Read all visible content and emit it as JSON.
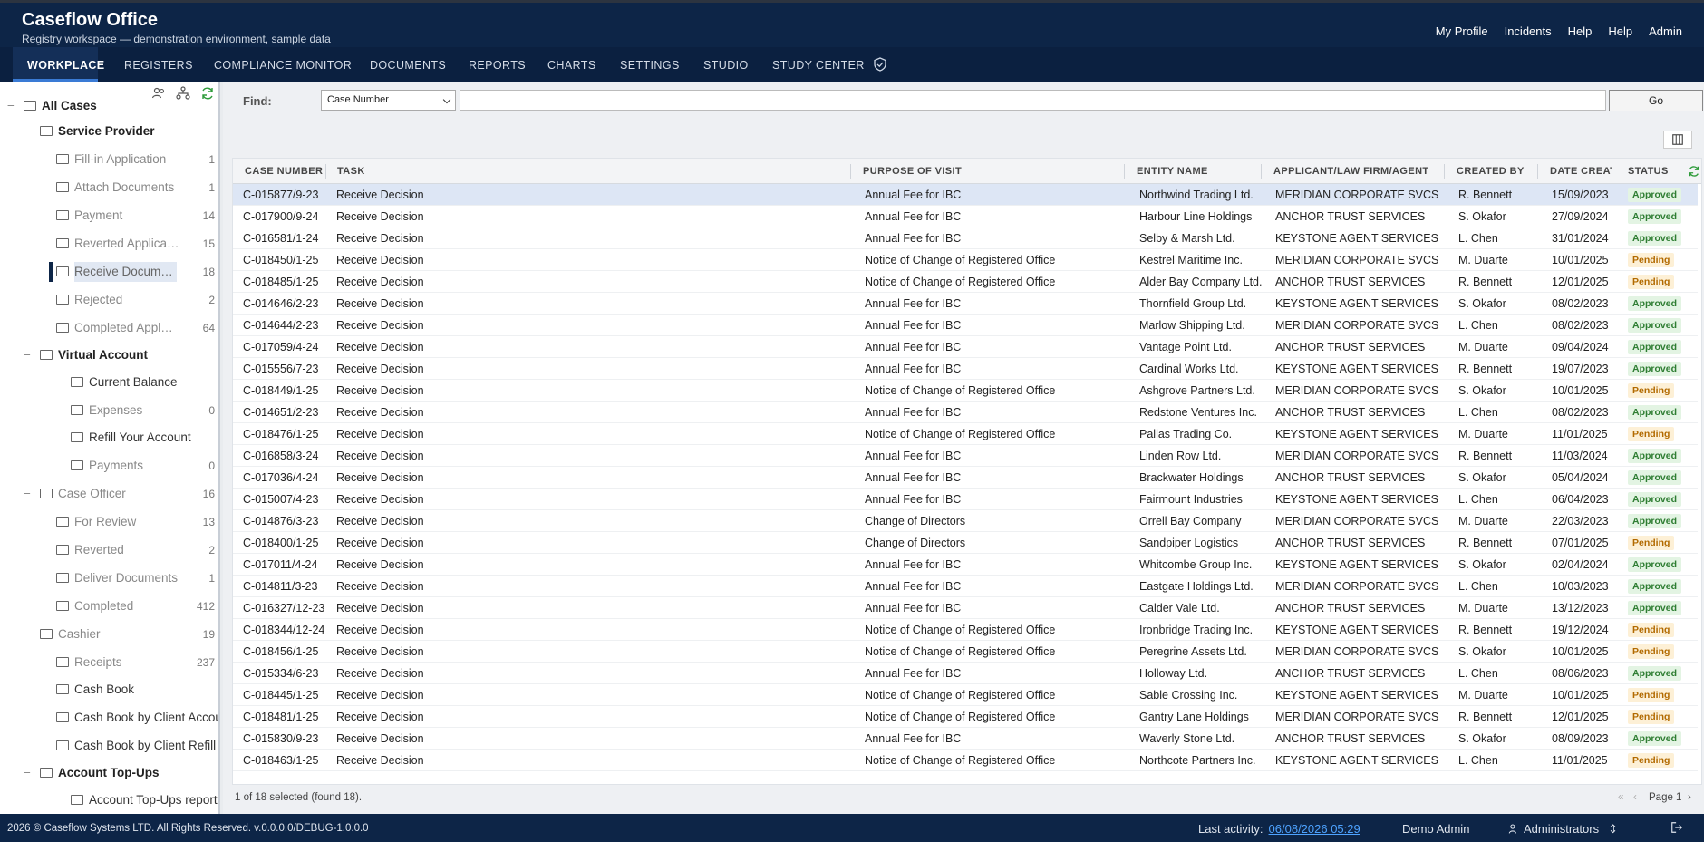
{
  "app": {
    "title": "Caseflow Office",
    "subtitle": "Registry workspace — demonstration environment, sample data"
  },
  "top_links": [
    "My Profile",
    "Incidents",
    "Help",
    "Help",
    "Admin"
  ],
  "nav": {
    "tabs": [
      "WORKPLACE",
      "REGISTERS",
      "COMPLIANCE MONITOR",
      "DOCUMENTS",
      "REPORTS",
      "CHARTS",
      "SETTINGS",
      "STUDIO",
      "STUDY CENTER"
    ],
    "active": "WORKPLACE"
  },
  "tree": [
    {
      "label": "All Cases",
      "count": "",
      "toggle": "−",
      "style": "bold"
    },
    {
      "label": "Service Provider",
      "count": "",
      "toggle": "−",
      "style": "bold"
    },
    {
      "label": "Fill-in Application",
      "count": "1",
      "toggle": "",
      "style": ""
    },
    {
      "label": "Attach Documents",
      "count": "1",
      "toggle": "",
      "style": ""
    },
    {
      "label": "Payment",
      "count": "14",
      "toggle": "",
      "style": ""
    },
    {
      "label": "Reverted Applica…",
      "count": "15",
      "toggle": "",
      "style": ""
    },
    {
      "label": "Receive Docum…",
      "count": "18",
      "toggle": "",
      "style": "sel"
    },
    {
      "label": "Rejected",
      "count": "2",
      "toggle": "",
      "style": ""
    },
    {
      "label": "Completed Appl…",
      "count": "64",
      "toggle": "",
      "style": ""
    },
    {
      "label": "Virtual Account",
      "count": "",
      "toggle": "−",
      "style": "bold"
    },
    {
      "label": "Current Balance",
      "count": "",
      "toggle": "",
      "style": "dark"
    },
    {
      "label": "Expenses",
      "count": "0",
      "toggle": "",
      "style": ""
    },
    {
      "label": "Refill Your Account",
      "count": "",
      "toggle": "",
      "style": "dark"
    },
    {
      "label": "Payments",
      "count": "0",
      "toggle": "",
      "style": ""
    },
    {
      "label": "Case Officer",
      "count": "16",
      "toggle": "−",
      "style": ""
    },
    {
      "label": "For Review",
      "count": "13",
      "toggle": "",
      "style": ""
    },
    {
      "label": "Reverted",
      "count": "2",
      "toggle": "",
      "style": ""
    },
    {
      "label": "Deliver Documents",
      "count": "1",
      "toggle": "",
      "style": ""
    },
    {
      "label": "Completed",
      "count": "412",
      "toggle": "",
      "style": ""
    },
    {
      "label": "Cashier",
      "count": "19",
      "toggle": "−",
      "style": ""
    },
    {
      "label": "Receipts",
      "count": "237",
      "toggle": "",
      "style": ""
    },
    {
      "label": "Cash Book",
      "count": "",
      "toggle": "",
      "style": "dark"
    },
    {
      "label": "Cash Book by Client Accou",
      "count": "",
      "toggle": "",
      "style": "dark"
    },
    {
      "label": "Cash Book by Client Refill",
      "count": "",
      "toggle": "",
      "style": "dark"
    },
    {
      "label": "Account Top-Ups",
      "count": "",
      "toggle": "−",
      "style": "bold"
    },
    {
      "label": "Account Top-Ups report",
      "count": "",
      "toggle": "",
      "style": "dark"
    }
  ],
  "find": {
    "label": "Find:",
    "select_value": "Case Number",
    "go": "Go"
  },
  "grid": {
    "columns": [
      "CASE NUMBER",
      "TASK",
      "PURPOSE OF VISIT",
      "ENTITY NAME",
      "APPLICANT/LAW FIRM/AGENT",
      "CREATED BY",
      "DATE CREATE",
      "STATUS"
    ],
    "rows": [
      [
        "C-015877/9-23",
        "Receive Decision",
        "Annual Fee for IBC",
        "Northwind Trading Ltd.",
        "MERIDIAN CORPORATE SVCS",
        "R. Bennett",
        "15/09/2023",
        "Approved"
      ],
      [
        "C-017900/9-24",
        "Receive Decision",
        "Annual Fee for IBC",
        "Harbour Line Holdings",
        "ANCHOR TRUST SERVICES",
        "S. Okafor",
        "27/09/2024",
        "Approved"
      ],
      [
        "C-016581/1-24",
        "Receive Decision",
        "Annual Fee for IBC",
        "Selby & Marsh Ltd.",
        "KEYSTONE AGENT SERVICES",
        "L. Chen",
        "31/01/2024",
        "Approved"
      ],
      [
        "C-018450/1-25",
        "Receive Decision",
        "Notice of Change of Registered Office",
        "Kestrel Maritime Inc.",
        "MERIDIAN CORPORATE SVCS",
        "M. Duarte",
        "10/01/2025",
        "Pending"
      ],
      [
        "C-018485/1-25",
        "Receive Decision",
        "Notice of Change of Registered Office",
        "Alder Bay Company Ltd.",
        "ANCHOR TRUST SERVICES",
        "R. Bennett",
        "12/01/2025",
        "Pending"
      ],
      [
        "C-014646/2-23",
        "Receive Decision",
        "Annual Fee for IBC",
        "Thornfield Group Ltd.",
        "KEYSTONE AGENT SERVICES",
        "S. Okafor",
        "08/02/2023",
        "Approved"
      ],
      [
        "C-014644/2-23",
        "Receive Decision",
        "Annual Fee for IBC",
        "Marlow Shipping Ltd.",
        "MERIDIAN CORPORATE SVCS",
        "L. Chen",
        "08/02/2023",
        "Approved"
      ],
      [
        "C-017059/4-24",
        "Receive Decision",
        "Annual Fee for IBC",
        "Vantage Point Ltd.",
        "ANCHOR TRUST SERVICES",
        "M. Duarte",
        "09/04/2024",
        "Approved"
      ],
      [
        "C-015556/7-23",
        "Receive Decision",
        "Annual Fee for IBC",
        "Cardinal Works Ltd.",
        "KEYSTONE AGENT SERVICES",
        "R. Bennett",
        "19/07/2023",
        "Approved"
      ],
      [
        "C-018449/1-25",
        "Receive Decision",
        "Notice of Change of Registered Office",
        "Ashgrove Partners Ltd.",
        "MERIDIAN CORPORATE SVCS",
        "S. Okafor",
        "10/01/2025",
        "Pending"
      ],
      [
        "C-014651/2-23",
        "Receive Decision",
        "Annual Fee for IBC",
        "Redstone Ventures Inc.",
        "ANCHOR TRUST SERVICES",
        "L. Chen",
        "08/02/2023",
        "Approved"
      ],
      [
        "C-018476/1-25",
        "Receive Decision",
        "Notice of Change of Registered Office",
        "Pallas Trading Co.",
        "KEYSTONE AGENT SERVICES",
        "M. Duarte",
        "11/01/2025",
        "Pending"
      ],
      [
        "C-016858/3-24",
        "Receive Decision",
        "Annual Fee for IBC",
        "Linden Row Ltd.",
        "MERIDIAN CORPORATE SVCS",
        "R. Bennett",
        "11/03/2024",
        "Approved"
      ],
      [
        "C-017036/4-24",
        "Receive Decision",
        "Annual Fee for IBC",
        "Brackwater Holdings",
        "ANCHOR TRUST SERVICES",
        "S. Okafor",
        "05/04/2024",
        "Approved"
      ],
      [
        "C-015007/4-23",
        "Receive Decision",
        "Annual Fee for IBC",
        "Fairmount Industries",
        "KEYSTONE AGENT SERVICES",
        "L. Chen",
        "06/04/2023",
        "Approved"
      ],
      [
        "C-014876/3-23",
        "Receive Decision",
        "Change of Directors",
        "Orrell Bay Company",
        "MERIDIAN CORPORATE SVCS",
        "M. Duarte",
        "22/03/2023",
        "Approved"
      ],
      [
        "C-018400/1-25",
        "Receive Decision",
        "Change of Directors",
        "Sandpiper Logistics",
        "ANCHOR TRUST SERVICES",
        "R. Bennett",
        "07/01/2025",
        "Pending"
      ],
      [
        "C-017011/4-24",
        "Receive Decision",
        "Annual Fee for IBC",
        "Whitcombe Group Inc.",
        "KEYSTONE AGENT SERVICES",
        "S. Okafor",
        "02/04/2024",
        "Approved"
      ],
      [
        "C-014811/3-23",
        "Receive Decision",
        "Annual Fee for IBC",
        "Eastgate Holdings Ltd.",
        "MERIDIAN CORPORATE SVCS",
        "L. Chen",
        "10/03/2023",
        "Approved"
      ],
      [
        "C-016327/12-23",
        "Receive Decision",
        "Annual Fee for IBC",
        "Calder Vale Ltd.",
        "ANCHOR TRUST SERVICES",
        "M. Duarte",
        "13/12/2023",
        "Approved"
      ],
      [
        "C-018344/12-24",
        "Receive Decision",
        "Notice of Change of Registered Office",
        "Ironbridge Trading Inc.",
        "KEYSTONE AGENT SERVICES",
        "R. Bennett",
        "19/12/2024",
        "Pending"
      ],
      [
        "C-018456/1-25",
        "Receive Decision",
        "Notice of Change of Registered Office",
        "Peregrine Assets Ltd.",
        "MERIDIAN CORPORATE SVCS",
        "S. Okafor",
        "10/01/2025",
        "Pending"
      ],
      [
        "C-015334/6-23",
        "Receive Decision",
        "Annual Fee for IBC",
        "Holloway Ltd.",
        "ANCHOR TRUST SERVICES",
        "L. Chen",
        "08/06/2023",
        "Approved"
      ],
      [
        "C-018445/1-25",
        "Receive Decision",
        "Notice of Change of Registered Office",
        "Sable Crossing Inc.",
        "KEYSTONE AGENT SERVICES",
        "M. Duarte",
        "10/01/2025",
        "Pending"
      ],
      [
        "C-018481/1-25",
        "Receive Decision",
        "Notice of Change of Registered Office",
        "Gantry Lane Holdings",
        "MERIDIAN CORPORATE SVCS",
        "R. Bennett",
        "12/01/2025",
        "Pending"
      ],
      [
        "C-015830/9-23",
        "Receive Decision",
        "Annual Fee for IBC",
        "Waverly Stone Ltd.",
        "ANCHOR TRUST SERVICES",
        "S. Okafor",
        "08/09/2023",
        "Approved"
      ],
      [
        "C-018463/1-25",
        "Receive Decision",
        "Notice of Change of Registered Office",
        "Northcote Partners Inc.",
        "KEYSTONE AGENT SERVICES",
        "L. Chen",
        "11/01/2025",
        "Pending"
      ]
    ],
    "status_colors": {
      "Approved": "#2e7d32",
      "Pending": "#b26a00"
    },
    "footer_text": "1 of 18 selected (found 18).",
    "page": "Page 1"
  },
  "footer": {
    "copyright": "2026 © Caseflow Systems LTD. All Rights Reserved. v.0.0.0.0/DEBUG-1.0.0.0",
    "activity_label": "Last activity:",
    "activity_value": "06/08/2026 05:29",
    "user": "Demo Admin",
    "group": "Administrators"
  }
}
